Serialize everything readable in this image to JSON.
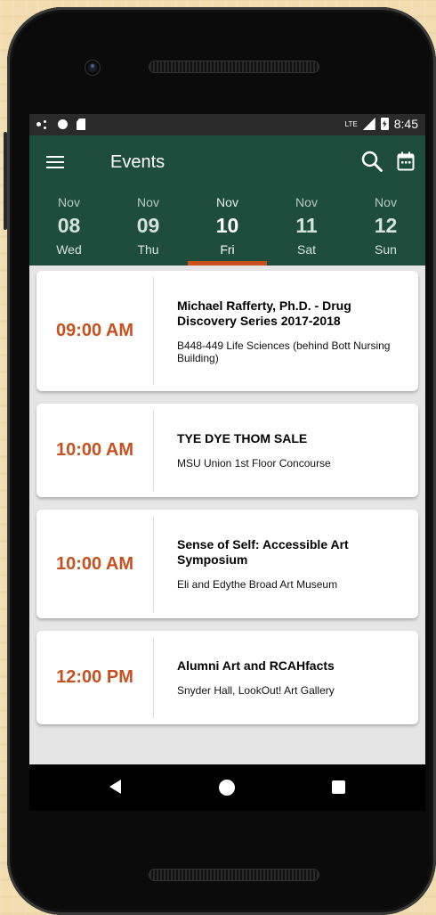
{
  "status_bar": {
    "network": "LTE",
    "time": "8:45"
  },
  "app_bar": {
    "title": "Events",
    "icons": [
      "menu-icon",
      "search-icon",
      "calendar-icon"
    ]
  },
  "date_strip": {
    "selected_index": 2,
    "days": [
      {
        "month": "Nov",
        "date": "08",
        "weekday": "Wed"
      },
      {
        "month": "Nov",
        "date": "09",
        "weekday": "Thu"
      },
      {
        "month": "Nov",
        "date": "10",
        "weekday": "Fri"
      },
      {
        "month": "Nov",
        "date": "11",
        "weekday": "Sat"
      },
      {
        "month": "Nov",
        "date": "12",
        "weekday": "Sun"
      }
    ]
  },
  "events": [
    {
      "time": "09:00 AM",
      "title": "Michael Rafferty, Ph.D. - Drug Discovery Series 2017-2018",
      "location": "B448-449 Life Sciences  (behind Bott Nursing Building)"
    },
    {
      "time": "10:00 AM",
      "title": "TYE DYE THOM SALE",
      "location": "MSU Union 1st Floor Concourse"
    },
    {
      "time": "10:00 AM",
      "title": "Sense of Self: Accessible Art Symposium",
      "location": "Eli and Edythe Broad Art Museum"
    },
    {
      "time": "12:00 PM",
      "title": "Alumni Art and RCAHfacts",
      "location": "Snyder Hall, LookOut! Art Gallery"
    }
  ],
  "colors": {
    "app_bar": "#1e4d3e",
    "accent": "#c8501e",
    "card_bg": "#ffffff",
    "screen_bg": "#e5e5e5"
  },
  "nav_bar": {
    "icons": [
      "back-icon",
      "home-icon",
      "recents-icon"
    ]
  }
}
